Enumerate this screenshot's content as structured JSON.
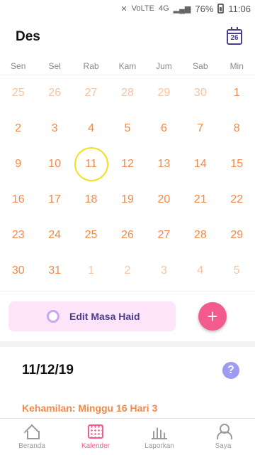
{
  "status_bar": {
    "network_label": "VoLTE",
    "signal_label": "4G",
    "battery": "76%",
    "time": "11:06"
  },
  "header": {
    "month": "Des",
    "today_icon_day": "26"
  },
  "weekdays": [
    "Sen",
    "Sel",
    "Rab",
    "Kam",
    "Jum",
    "Sab",
    "Min"
  ],
  "calendar": {
    "days": [
      {
        "label": "25",
        "faded": true
      },
      {
        "label": "26",
        "faded": true
      },
      {
        "label": "27",
        "faded": true
      },
      {
        "label": "28",
        "faded": true
      },
      {
        "label": "29",
        "faded": true
      },
      {
        "label": "30",
        "faded": true
      },
      {
        "label": "1",
        "faded": false
      },
      {
        "label": "2",
        "faded": false
      },
      {
        "label": "3",
        "faded": false
      },
      {
        "label": "4",
        "faded": false
      },
      {
        "label": "5",
        "faded": false
      },
      {
        "label": "6",
        "faded": false
      },
      {
        "label": "7",
        "faded": false
      },
      {
        "label": "8",
        "faded": false
      },
      {
        "label": "9",
        "faded": false
      },
      {
        "label": "10",
        "faded": false
      },
      {
        "label": "11",
        "faded": false,
        "today": true
      },
      {
        "label": "12",
        "faded": false
      },
      {
        "label": "13",
        "faded": false
      },
      {
        "label": "14",
        "faded": false
      },
      {
        "label": "15",
        "faded": false
      },
      {
        "label": "16",
        "faded": false
      },
      {
        "label": "17",
        "faded": false
      },
      {
        "label": "18",
        "faded": false
      },
      {
        "label": "19",
        "faded": false
      },
      {
        "label": "20",
        "faded": false
      },
      {
        "label": "21",
        "faded": false
      },
      {
        "label": "22",
        "faded": false
      },
      {
        "label": "23",
        "faded": false
      },
      {
        "label": "24",
        "faded": false
      },
      {
        "label": "25",
        "faded": false
      },
      {
        "label": "26",
        "faded": false
      },
      {
        "label": "27",
        "faded": false
      },
      {
        "label": "28",
        "faded": false
      },
      {
        "label": "29",
        "faded": false
      },
      {
        "label": "30",
        "faded": false
      },
      {
        "label": "31",
        "faded": false
      },
      {
        "label": "1",
        "faded": true
      },
      {
        "label": "2",
        "faded": true
      },
      {
        "label": "3",
        "faded": true
      },
      {
        "label": "4",
        "faded": true
      },
      {
        "label": "5",
        "faded": true
      }
    ]
  },
  "actions": {
    "edit_period_label": "Edit Masa Haid",
    "add_label": "+"
  },
  "detail": {
    "selected_date": "11/12/19",
    "help_label": "?",
    "pregnancy_text": "Kehamilan: Minggu 16 Hari 3"
  },
  "bottom_nav": {
    "items": [
      {
        "label": "Beranda",
        "icon": "home-icon"
      },
      {
        "label": "Kalender",
        "icon": "calendar-icon",
        "active": true
      },
      {
        "label": "Laporkan",
        "icon": "chart-icon"
      },
      {
        "label": "Saya",
        "icon": "user-icon"
      }
    ]
  },
  "colors": {
    "accent_pink": "#f45b8d",
    "day_orange": "#f08a4b",
    "day_faded": "#f6c3a2",
    "today_ring": "#f2e024",
    "purple": "#4a3f8f"
  }
}
